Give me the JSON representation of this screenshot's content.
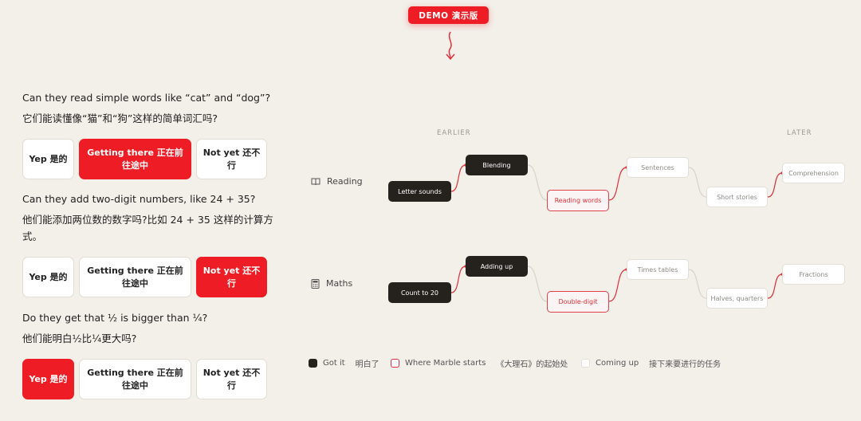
{
  "badge": {
    "label": "DEMO  演示版"
  },
  "questions": [
    {
      "en": "Can they read simple words like “cat” and “dog”?",
      "zh": "它们能读懂像“猫”和“狗”这样的简单词汇吗?",
      "options": [
        "Yep 是的",
        "Getting there 正在前往途中",
        "Not yet 还不行"
      ],
      "selected": 1
    },
    {
      "en": "Can they add two-digit numbers, like 24 + 35?",
      "zh": "他们能添加两位数的数字吗?比如 24 + 35 这样的计算方式。",
      "options": [
        "Yep 是的",
        "Getting there 正在前往途中",
        "Not yet 还不行"
      ],
      "selected": 2
    },
    {
      "en": "Do they get that ½ is bigger than ¼?",
      "zh": "他们能明白½比¼更大吗?",
      "options": [
        "Yep 是的",
        "Getting there 正在前往途中",
        "Not yet 还不行"
      ],
      "selected": 0
    }
  ],
  "map": {
    "earlier": "EARLIER",
    "later": "LATER",
    "rows": [
      {
        "label": "Reading",
        "icon": "book-icon",
        "nodes": [
          "Letter sounds",
          "Blending",
          "Reading words",
          "Sentences",
          "Short stories",
          "Comprehension"
        ],
        "states": [
          "got",
          "got",
          "start",
          "up",
          "up",
          "up"
        ]
      },
      {
        "label": "Maths",
        "icon": "calculator-icon",
        "nodes": [
          "Count to 20",
          "Adding up",
          "Double-digit",
          "Times tables",
          "Halves, quarters",
          "Fractions"
        ],
        "states": [
          "got",
          "got",
          "start",
          "up",
          "up",
          "up"
        ]
      }
    ]
  },
  "legend": {
    "got_en": "Got it",
    "got_zh": "明白了",
    "start_en": "Where Marble starts",
    "start_zh": "《大理石》的起始处",
    "up_en": "Coming up",
    "up_zh": "接下来要进行的任务"
  },
  "colors": {
    "accent": "#ee1c25",
    "dark": "#25221e",
    "background": "#f3efe9"
  }
}
